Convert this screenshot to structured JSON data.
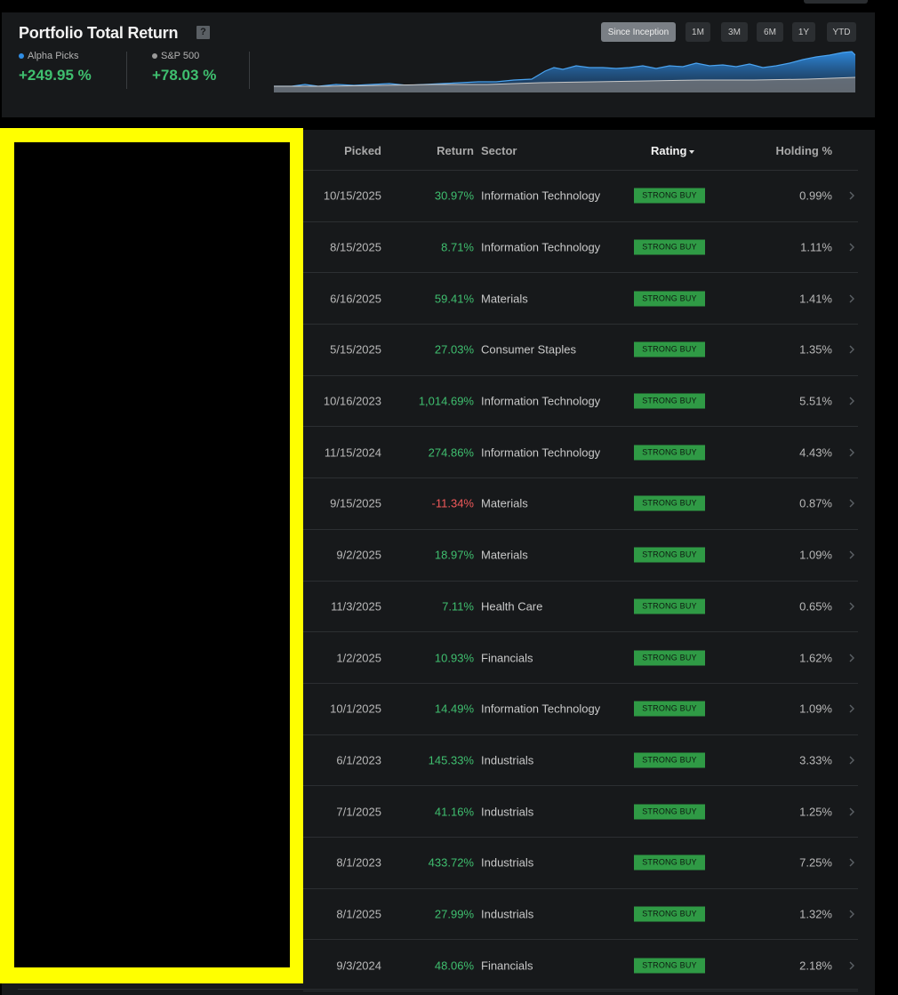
{
  "header": {
    "title": "Portfolio Total Return",
    "help_icon_text": "?",
    "metrics": [
      {
        "label": "Alpha Picks",
        "value": "+249.95 %",
        "dot_color": "#2f8de4"
      },
      {
        "label": "S&P 500",
        "value": "+78.03 %",
        "dot_color": "#9a9a9a"
      }
    ],
    "ranges": [
      {
        "label": "Since Inception",
        "active": true
      },
      {
        "label": "1M",
        "active": false
      },
      {
        "label": "3M",
        "active": false
      },
      {
        "label": "6M",
        "active": false
      },
      {
        "label": "1Y",
        "active": false
      },
      {
        "label": "YTD",
        "active": false
      }
    ]
  },
  "table": {
    "columns": {
      "picked": "Picked",
      "return": "Return",
      "sector": "Sector",
      "rating": "Rating",
      "holding": "Holding %"
    },
    "rows": [
      {
        "picked": "10/15/2025",
        "return": "30.97%",
        "sector": "Information Technology",
        "rating": "STRONG BUY",
        "holding": "0.99%"
      },
      {
        "picked": "8/15/2025",
        "return": "8.71%",
        "sector": "Information Technology",
        "rating": "STRONG BUY",
        "holding": "1.11%"
      },
      {
        "picked": "6/16/2025",
        "return": "59.41%",
        "sector": "Materials",
        "rating": "STRONG BUY",
        "holding": "1.41%"
      },
      {
        "picked": "5/15/2025",
        "return": "27.03%",
        "sector": "Consumer Staples",
        "rating": "STRONG BUY",
        "holding": "1.35%"
      },
      {
        "picked": "10/16/2023",
        "return": "1,014.69%",
        "sector": "Information Technology",
        "rating": "STRONG BUY",
        "holding": "5.51%"
      },
      {
        "picked": "11/15/2024",
        "return": "274.86%",
        "sector": "Information Technology",
        "rating": "STRONG BUY",
        "holding": "4.43%"
      },
      {
        "picked": "9/15/2025",
        "return": "-11.34%",
        "sector": "Materials",
        "rating": "STRONG BUY",
        "holding": "0.87%"
      },
      {
        "picked": "9/2/2025",
        "return": "18.97%",
        "sector": "Materials",
        "rating": "STRONG BUY",
        "holding": "1.09%"
      },
      {
        "picked": "11/3/2025",
        "return": "7.11%",
        "sector": "Health Care",
        "rating": "STRONG BUY",
        "holding": "0.65%"
      },
      {
        "picked": "1/2/2025",
        "return": "10.93%",
        "sector": "Financials",
        "rating": "STRONG BUY",
        "holding": "1.62%"
      },
      {
        "picked": "10/1/2025",
        "return": "14.49%",
        "sector": "Information Technology",
        "rating": "STRONG BUY",
        "holding": "1.09%"
      },
      {
        "picked": "6/1/2023",
        "return": "145.33%",
        "sector": "Industrials",
        "rating": "STRONG BUY",
        "holding": "3.33%"
      },
      {
        "picked": "7/1/2025",
        "return": "41.16%",
        "sector": "Industrials",
        "rating": "STRONG BUY",
        "holding": "1.25%"
      },
      {
        "picked": "8/1/2023",
        "return": "433.72%",
        "sector": "Industrials",
        "rating": "STRONG BUY",
        "holding": "7.25%"
      },
      {
        "picked": "8/1/2025",
        "return": "27.99%",
        "sector": "Industrials",
        "rating": "STRONG BUY",
        "holding": "1.32%"
      },
      {
        "picked": "9/3/2024",
        "return": "48.06%",
        "sector": "Financials",
        "rating": "STRONG BUY",
        "holding": "2.18%"
      }
    ]
  },
  "colors": {
    "positive": "#3fbf6f",
    "negative": "#f0595a",
    "rating_badge": "#2f9a45",
    "highlight": "#ffff00"
  },
  "icons": {
    "row_action": "chevron-right-icon",
    "sort": "caret-down-icon"
  }
}
